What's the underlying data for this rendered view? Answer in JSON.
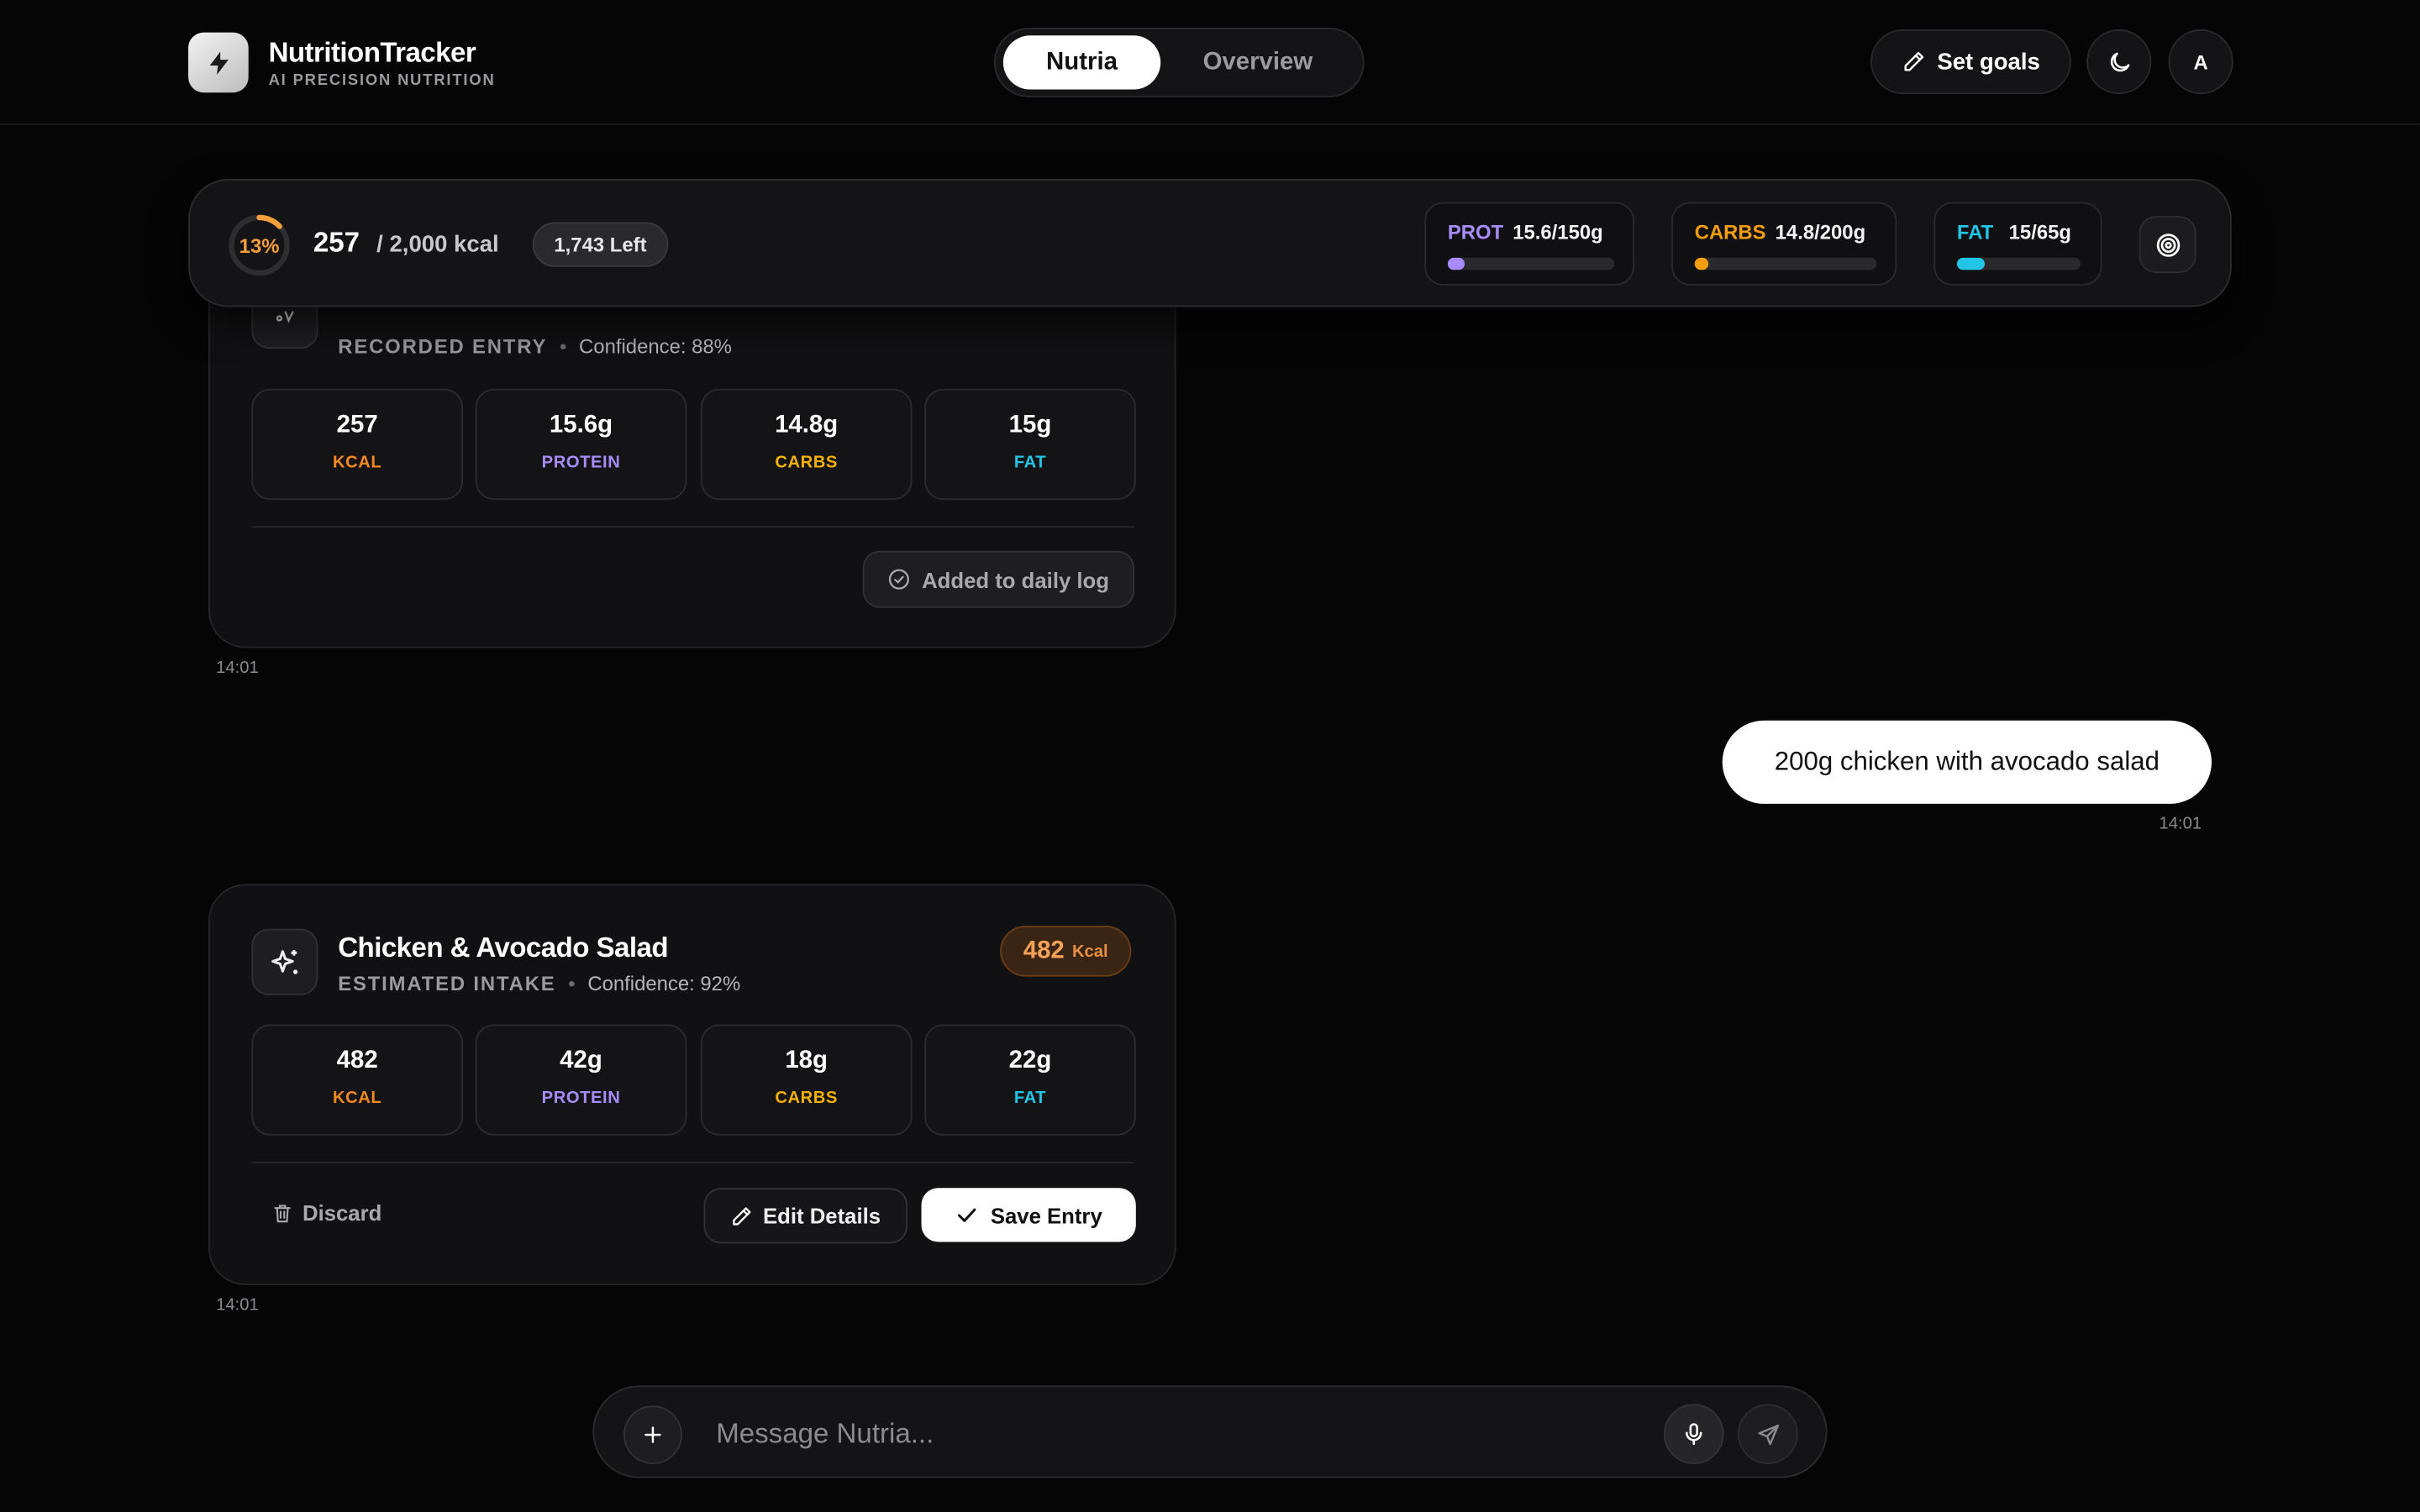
{
  "app": {
    "title": "NutritionTracker",
    "subtitle": "AI PRECISION NUTRITION",
    "tabs": [
      "Nutria",
      "Overview"
    ],
    "active_tab": "Nutria",
    "set_goals_label": "Set goals",
    "avatar_initial": "A",
    "icons": {
      "logo": "bolt-icon",
      "set_goals": "pencil-icon",
      "theme": "moon-icon"
    }
  },
  "summary": {
    "percent_text": "13%",
    "percent_value": 0.13,
    "eaten": "257",
    "goal_text": "/ 2,000 kcal",
    "left_text": "1,743 Left",
    "macros": [
      {
        "key": "prot",
        "name": "PROT",
        "value_text": "15.6/150g",
        "fraction": 0.104,
        "color": "#a78bfa"
      },
      {
        "key": "carbs",
        "name": "CARBS",
        "value_text": "14.8/200g",
        "fraction": 0.074,
        "color": "#f59e0b"
      },
      {
        "key": "fat",
        "name": "FAT",
        "value_text": "15/65g",
        "fraction": 0.23,
        "color": "#22c5e6"
      }
    ],
    "target_icon": "target-icon"
  },
  "colors": {
    "kcal": "#f5891f",
    "protein": "#a78bfa",
    "carbs": "#f6b100",
    "fat": "#22c5e6"
  },
  "entries": [
    {
      "type_label": "RECORDED ENTRY",
      "confidence": "Confidence: 88%",
      "icon": "checkmark-icon",
      "stats": [
        {
          "value": "257",
          "label": "KCAL"
        },
        {
          "value": "15.6g",
          "label": "PROTEIN"
        },
        {
          "value": "14.8g",
          "label": "CARBS"
        },
        {
          "value": "15g",
          "label": "FAT"
        }
      ],
      "status_label": "Added to daily log",
      "time": "14:01"
    },
    {
      "title": "Chicken & Avocado Salad",
      "type_label": "ESTIMATED INTAKE",
      "confidence": "Confidence: 92%",
      "icon": "sparkles-icon",
      "kcal_badge": {
        "value": "482",
        "unit": "Kcal"
      },
      "stats": [
        {
          "value": "482",
          "label": "KCAL"
        },
        {
          "value": "42g",
          "label": "PROTEIN"
        },
        {
          "value": "18g",
          "label": "CARBS"
        },
        {
          "value": "22g",
          "label": "FAT"
        }
      ],
      "discard_label": "Discard",
      "edit_label": "Edit Details",
      "save_label": "Save Entry",
      "time": "14:01"
    }
  ],
  "user_message": {
    "text": "200g chicken with avocado salad",
    "time": "14:01"
  },
  "composer": {
    "placeholder": "Message Nutria..."
  }
}
